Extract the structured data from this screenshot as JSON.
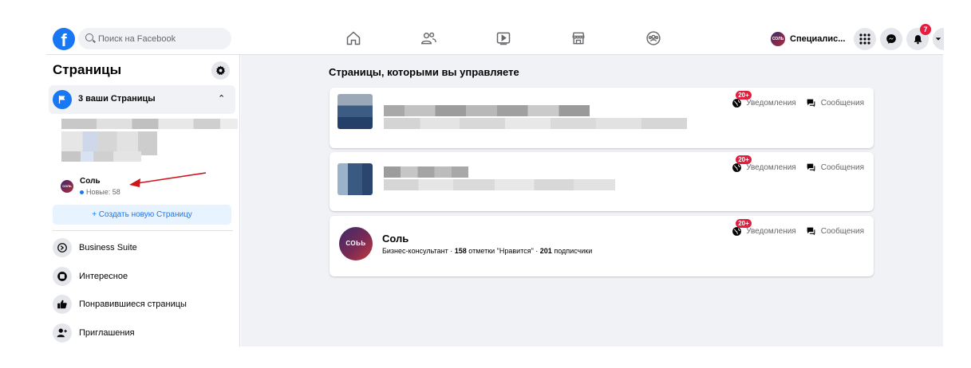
{
  "search": {
    "placeholder": "Поиск на Facebook"
  },
  "header": {
    "logo": "f",
    "profile_avatar_text": "СОЛЬ",
    "profile_name": "Специалис...",
    "notifications_count": "7",
    "nav_icons": [
      "home-icon",
      "friends-icon",
      "watch-icon",
      "marketplace-icon",
      "groups-icon"
    ]
  },
  "sidebar": {
    "title": "Страницы",
    "pages_group_label": "3 ваши Страницы",
    "sol_page": {
      "avatar_text": "СОЛЬ",
      "name": "Соль",
      "new_label": "Новые: 58"
    },
    "create_page_label": "+ Создать новую Страницу",
    "menu": [
      {
        "icon": "business-suite-icon",
        "label": "Business Suite"
      },
      {
        "icon": "discover-icon",
        "label": "Интересное"
      },
      {
        "icon": "liked-pages-icon",
        "label": "Понравившиеся страницы"
      },
      {
        "icon": "invites-icon",
        "label": "Приглашения"
      }
    ]
  },
  "main": {
    "title": "Страницы, которыми вы управляете",
    "cards": [
      {
        "notifications_badge": "20+",
        "notifications_label": "Уведомления",
        "messages_label": "Сообщения"
      },
      {
        "notifications_badge": "20+",
        "notifications_label": "Уведомления",
        "messages_label": "Сообщения"
      },
      {
        "avatar_text": "СОЬЬ",
        "name": "Соль",
        "category": "Бизнес-консультант",
        "likes_count": "158",
        "likes_label": "отметки \"Нравится\"",
        "followers_count": "201",
        "followers_label": "подписчики",
        "notifications_badge": "20+",
        "notifications_label": "Уведомления",
        "messages_label": "Сообщения"
      }
    ]
  },
  "colors": {
    "accent": "#1877f2",
    "badge": "#e41e3f",
    "main_bg": "#f0f2f5",
    "arrow": "#d0141c"
  }
}
